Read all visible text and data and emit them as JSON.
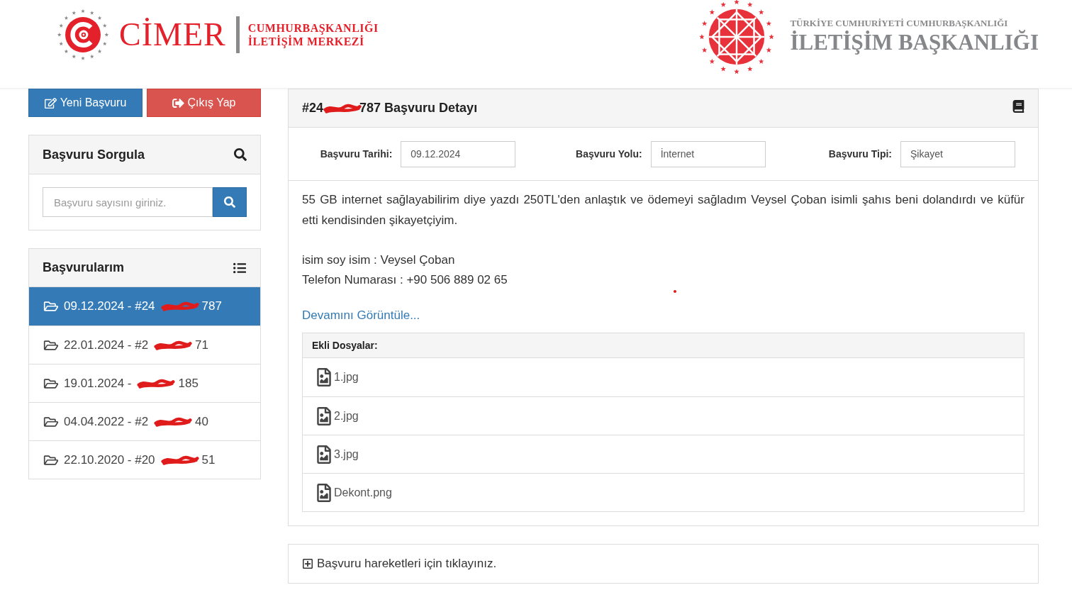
{
  "header": {
    "cimer_logo": {
      "wordmark": "CİMER",
      "line_1": "CUMHURBAŞKANLIĞI",
      "line_2": "İLETİŞİM MERKEZİ"
    },
    "directorate_logo": {
      "line_1": "TÜRKİYE CUMHURİYETİ CUMHURBAŞKANLIĞI",
      "line_2": "İLETİŞİM BAŞKANLIĞI"
    }
  },
  "sidebar": {
    "buttons": [
      {
        "kind": "new",
        "label": "Yeni Başvuru"
      },
      {
        "kind": "logout",
        "label": "Çıkış Yap"
      }
    ],
    "query_panel": {
      "title": "Başvuru Sorgula",
      "placeholder": "Başvuru sayısını giriniz."
    },
    "applications_panel": {
      "title": "Başvurularım",
      "items": [
        {
          "text": "09.12.2024 - #24",
          "text_after_redaction": "787",
          "selected": true
        },
        {
          "text": "22.01.2024 - #2",
          "text_after_redaction": "71",
          "selected": false
        },
        {
          "text": "19.01.2024 -",
          "text_after_redaction": "185",
          "selected": false
        },
        {
          "text": "04.04.2022 - #2",
          "text_after_redaction": "40",
          "selected": false
        },
        {
          "text": "22.10.2020 - #20",
          "text_after_redaction": "51",
          "selected": false
        }
      ]
    }
  },
  "detail": {
    "title_start": "#24",
    "title_end": "787 Başvuru Detayı",
    "fields": [
      {
        "label": "Başvuru Tarihi:",
        "value": "09.12.2024"
      },
      {
        "label": "Başvuru Yolu:",
        "value": "İnternet"
      },
      {
        "label": "Başvuru Tipi:",
        "value": "Şikayet"
      }
    ],
    "description": [
      [
        "55 GB internet sağlayabilirim diye yazdı 250TL'den anlaştık ve ödemeyi sağladım Veysel Çoban isimli şahıs beni dolandırdı ve küfür etti kendisinden şikayetçiyim."
      ],
      [
        "isim soy isim : Veysel Çoban",
        "Telefon Numarası : +90 506 889 02 65"
      ]
    ],
    "more_link": "Devamını Görüntüle...",
    "attachments": {
      "title": "Ekli Dosyalar:",
      "files": [
        {
          "name": "1.jpg"
        },
        {
          "name": "2.jpg"
        },
        {
          "name": "3.jpg"
        },
        {
          "name": "Dekont.png"
        }
      ]
    }
  },
  "history_panel": {
    "label": "Başvuru hareketleri için tıklayınız.",
    "expanded": false
  }
}
